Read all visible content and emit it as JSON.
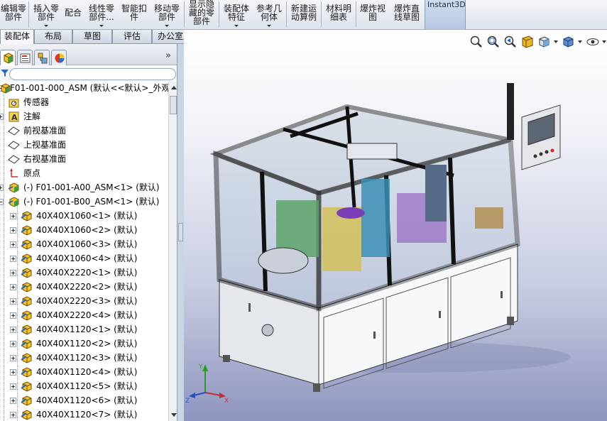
{
  "ribbon": {
    "buttons": [
      {
        "label": "编辑零\n部件"
      },
      {
        "label": "插入零\n部件"
      },
      {
        "label": "配合"
      },
      {
        "label": "线性零\n部件..."
      },
      {
        "label": "智能扣\n件"
      },
      {
        "label": "移动零\n部件"
      },
      {
        "label": "显示隐\n藏的零\n部件"
      },
      {
        "label": "装配体\n特征"
      },
      {
        "label": "参考几\n何体"
      },
      {
        "label": "新建运\n动算例"
      },
      {
        "label": "材料明\n细表"
      },
      {
        "label": "爆炸视\n图"
      },
      {
        "label": "爆炸直\n线草图"
      }
    ],
    "instant3d": "Instant3D"
  },
  "tabs": [
    "装配体",
    "布局",
    "草图",
    "评估",
    "办公室产品"
  ],
  "panel": {
    "expand_glyph": "»",
    "tree": [
      {
        "label": "F01-001-000_ASM  (默认<<默认>_外观",
        "icon": "assembly-root-icon",
        "exp": "minus",
        "level": 0
      },
      {
        "label": "传感器",
        "icon": "sensor-folder-icon",
        "exp": "none",
        "level": 1
      },
      {
        "label": "注解",
        "icon": "annotation-icon",
        "exp": "plus",
        "level": 1
      },
      {
        "label": "前视基准面",
        "icon": "plane-icon",
        "exp": "none",
        "level": 1
      },
      {
        "label": "上视基准面",
        "icon": "plane-icon",
        "exp": "none",
        "level": 1
      },
      {
        "label": "右视基准面",
        "icon": "plane-icon",
        "exp": "none",
        "level": 1
      },
      {
        "label": "原点",
        "icon": "origin-icon",
        "exp": "none",
        "level": 1
      },
      {
        "label": "(-) F01-001-A00_ASM<1> (默认)",
        "icon": "subassembly-icon",
        "exp": "plus",
        "level": 1
      },
      {
        "label": "(-) F01-001-B00_ASM<1> (默认)",
        "icon": "subassembly-icon",
        "exp": "minus",
        "level": 1
      },
      {
        "label": "40X40X1060<1> (默认)",
        "icon": "part-icon",
        "exp": "plus",
        "level": 2
      },
      {
        "label": "40X40X1060<2> (默认)",
        "icon": "part-icon",
        "exp": "plus",
        "level": 2
      },
      {
        "label": "40X40X1060<3> (默认)",
        "icon": "part-icon",
        "exp": "plus",
        "level": 2
      },
      {
        "label": "40X40X1060<4> (默认)",
        "icon": "part-icon",
        "exp": "plus",
        "level": 2
      },
      {
        "label": "40X40X2220<1> (默认)",
        "icon": "part-icon",
        "exp": "plus",
        "level": 2
      },
      {
        "label": "40X40X2220<2> (默认)",
        "icon": "part-icon",
        "exp": "plus",
        "level": 2
      },
      {
        "label": "40X40X2220<3> (默认)",
        "icon": "part-icon",
        "exp": "plus",
        "level": 2
      },
      {
        "label": "40X40X2220<4> (默认)",
        "icon": "part-icon",
        "exp": "plus",
        "level": 2
      },
      {
        "label": "40X40X1120<1> (默认)",
        "icon": "part-icon",
        "exp": "plus",
        "level": 2
      },
      {
        "label": "40X40X1120<2> (默认)",
        "icon": "part-icon",
        "exp": "plus",
        "level": 2
      },
      {
        "label": "40X40X1120<3> (默认)",
        "icon": "part-icon",
        "exp": "plus",
        "level": 2
      },
      {
        "label": "40X40X1120<4> (默认)",
        "icon": "part-icon",
        "exp": "plus",
        "level": 2
      },
      {
        "label": "40X40X1120<5> (默认)",
        "icon": "part-icon",
        "exp": "plus",
        "level": 2
      },
      {
        "label": "40X40X1120<6> (默认)",
        "icon": "part-icon",
        "exp": "plus",
        "level": 2
      },
      {
        "label": "40X40X1120<7> (默认)",
        "icon": "part-icon",
        "exp": "plus",
        "level": 2
      }
    ]
  },
  "view_toolbar": [
    "zoom-to-fit-icon",
    "zoom-to-area-icon",
    "previous-view-icon",
    "section-view-icon",
    "view-orientation-icon",
    "display-style-icon",
    "hide-show-items-icon"
  ],
  "triad": {
    "x": "X",
    "y": "Y",
    "z": "Z"
  },
  "colors": {
    "accent": "#b7c8e1",
    "frame": "#141414",
    "cabinet": "#eef0f3"
  }
}
